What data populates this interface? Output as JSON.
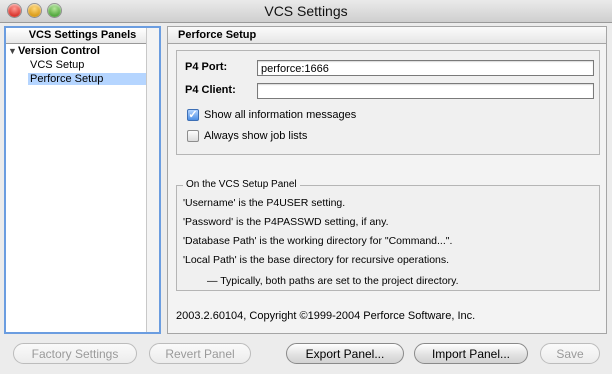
{
  "window": {
    "title": "VCS Settings"
  },
  "left_panel": {
    "header": "VCS Settings Panels",
    "group": "Version Control",
    "items": [
      {
        "label": "VCS Setup",
        "selected": false
      },
      {
        "label": "Perforce Setup",
        "selected": true
      }
    ]
  },
  "right_panel": {
    "header": "Perforce Setup",
    "p4port_label": "P4 Port:",
    "p4port_value": "perforce:1666",
    "p4client_label": "P4 Client:",
    "p4client_value": "",
    "checkbox_info_label": "Show all information messages",
    "checkbox_info_checked": true,
    "checkbox_jobs_label": "Always show job lists",
    "checkbox_jobs_checked": false,
    "info_box": {
      "legend": "On the VCS Setup Panel",
      "lines": [
        "'Username' is the P4USER setting.",
        "'Password' is the P4PASSWD setting, if any.",
        "'Database Path' is the working directory for \"Command...\".",
        "'Local Path' is the base directory for recursive operations.",
        "— Typically, both paths are set to the project directory."
      ]
    },
    "copyright": "2003.2.60104, Copyright ©1999-2004 Perforce Software, Inc."
  },
  "buttons": {
    "factory": "Factory Settings",
    "revert": "Revert Panel",
    "export": "Export Panel...",
    "import": "Import Panel...",
    "save": "Save"
  },
  "colors": {
    "selection": "#b5d5ff",
    "focus_ring": "#6b9de0"
  }
}
